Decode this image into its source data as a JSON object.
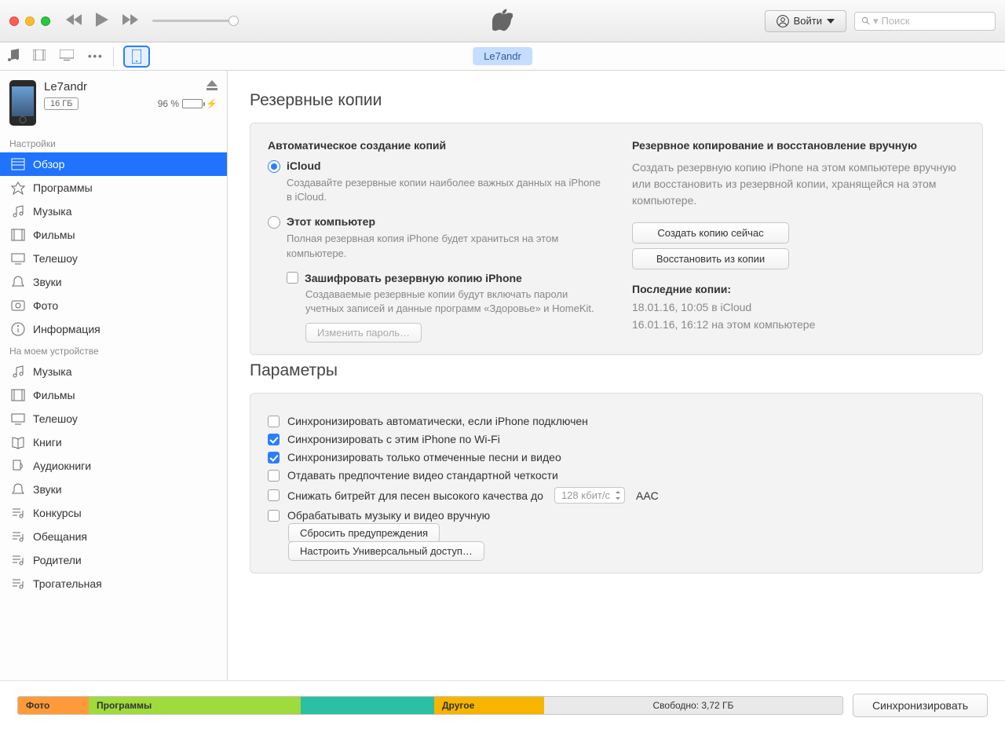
{
  "top": {
    "signin": "Войти",
    "search_placeholder": "Поиск"
  },
  "tabrow": {
    "device_pill": "Le7andr"
  },
  "device": {
    "name": "Le7andr",
    "capacity": "16 ГБ",
    "battery_pct": "96 %"
  },
  "sidebar": {
    "settings_header": "Настройки",
    "settings_items": [
      {
        "label": "Обзор",
        "icon": "overview"
      },
      {
        "label": "Программы",
        "icon": "apps"
      },
      {
        "label": "Музыка",
        "icon": "music"
      },
      {
        "label": "Фильмы",
        "icon": "films"
      },
      {
        "label": "Телешоу",
        "icon": "tv"
      },
      {
        "label": "Звуки",
        "icon": "tones"
      },
      {
        "label": "Фото",
        "icon": "photos"
      },
      {
        "label": "Информация",
        "icon": "info"
      }
    ],
    "device_header": "На моем устройстве",
    "device_items": [
      {
        "label": "Музыка",
        "icon": "music"
      },
      {
        "label": "Фильмы",
        "icon": "films"
      },
      {
        "label": "Телешоу",
        "icon": "tv"
      },
      {
        "label": "Книги",
        "icon": "books"
      },
      {
        "label": "Аудиокниги",
        "icon": "audiobooks"
      },
      {
        "label": "Звуки",
        "icon": "tones"
      },
      {
        "label": "Конкурсы",
        "icon": "playlist"
      },
      {
        "label": "Обещания",
        "icon": "playlist"
      },
      {
        "label": "Родители",
        "icon": "playlist"
      },
      {
        "label": "Трогательная",
        "icon": "playlist"
      }
    ]
  },
  "backup": {
    "section_title": "Резервные копии",
    "auto_heading": "Автоматическое создание копий",
    "icloud_label": "iCloud",
    "icloud_desc": "Создавайте резервные копии наиболее важных данных на iPhone в iCloud.",
    "computer_label": "Этот компьютер",
    "computer_desc": "Полная резервная копия iPhone будет храниться на этом компьютере.",
    "encrypt_label": "Зашифровать резервную копию iPhone",
    "encrypt_desc": "Создаваемые резервные копии будут включать пароли учетных записей и данные программ «Здоровье» и HomeKit.",
    "change_pass": "Изменить пароль…",
    "manual_heading": "Резервное копирование и восстановление вручную",
    "manual_desc": "Создать резервную копию iPhone на этом компьютере вручную или восстановить из резервной копии, хранящейся на этом компьютере.",
    "backup_now": "Создать копию сейчас",
    "restore": "Восстановить из копии",
    "latest_heading": "Последние копии:",
    "latest_line1": "18.01.16, 10:05 в iCloud",
    "latest_line2": "16.01.16, 16:12 на этом компьютере"
  },
  "options": {
    "section_title": "Параметры",
    "opt_auto": "Синхронизировать автоматически, если iPhone подключен",
    "opt_wifi": "Синхронизировать с этим iPhone по Wi-Fi",
    "opt_checked": "Синхронизировать только отмеченные песни и видео",
    "opt_sd": "Отдавать предпочтение видео стандартной четкости",
    "opt_bitrate": "Снижать битрейт для песен высокого качества до",
    "bitrate_value": "128 кбит/с",
    "bitrate_suffix": "AAC",
    "opt_manual": "Обрабатывать музыку и видео вручную",
    "reset_warnings": "Сбросить предупреждения",
    "universal_access": "Настроить Универсальный доступ…"
  },
  "storage": {
    "photo": "Фото",
    "apps": "Программы",
    "other": "Другое",
    "free": "Свободно: 3,72 ГБ",
    "sync_button": "Синхронизировать"
  }
}
